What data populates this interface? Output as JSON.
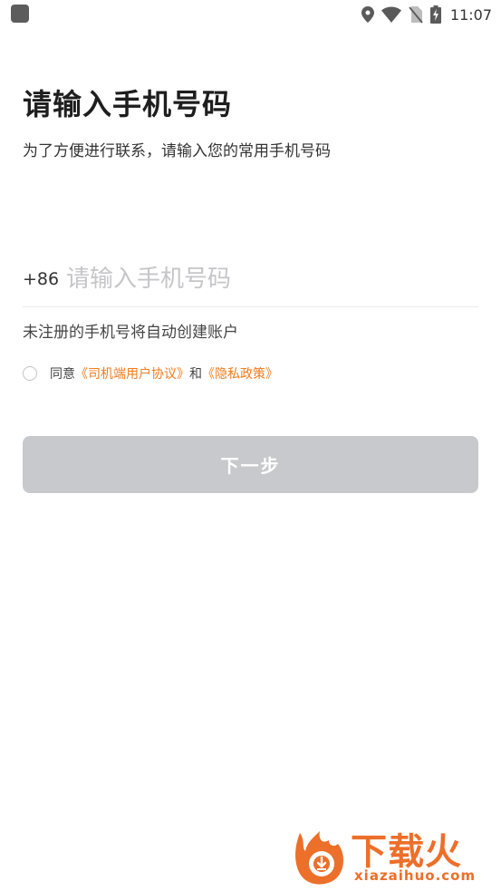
{
  "status_bar": {
    "time": "11:07",
    "icons": [
      "app-notification-icon",
      "location-icon",
      "wifi-icon",
      "no-sim-icon",
      "battery-charging-icon"
    ]
  },
  "page": {
    "title": "请输入手机号码",
    "subtitle": "为了方便进行联系，请输入您的常用手机号码"
  },
  "phone_input": {
    "country_code": "+86",
    "value": "",
    "placeholder": "请输入手机号码"
  },
  "hint": "未注册的手机号将自动创建账户",
  "agreement": {
    "prefix": "同意",
    "user_agreement": "《司机端用户协议》",
    "conjunction": "和",
    "privacy_policy": "《隐私政策》",
    "checked": false
  },
  "next_button": {
    "label": "下一步",
    "enabled": false,
    "color": "#c8c9cc"
  },
  "watermark": {
    "name_cn": "下载火",
    "name_en": "xiazaihuo.com",
    "color": "#ec6f2a"
  },
  "colors": {
    "link": "#f07c1f",
    "placeholder": "#c6c6c9",
    "text": "#222222"
  }
}
